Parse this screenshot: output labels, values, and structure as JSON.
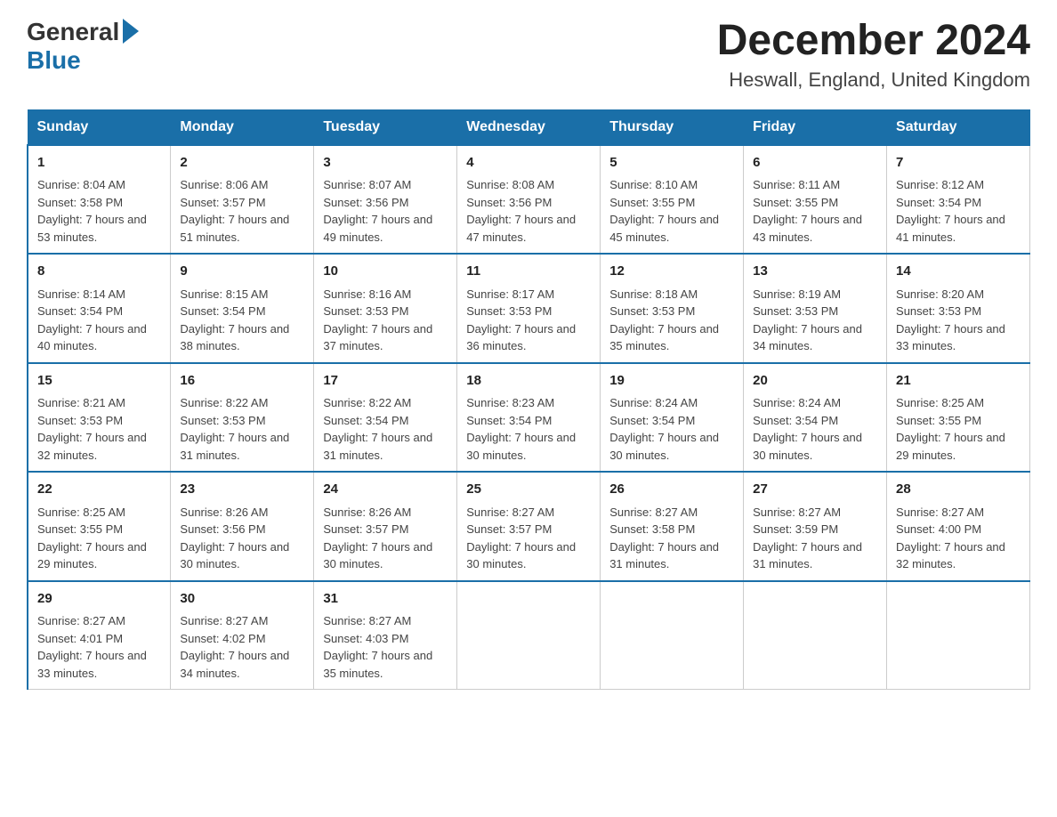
{
  "header": {
    "month_year": "December 2024",
    "location": "Heswall, England, United Kingdom",
    "logo_general": "General",
    "logo_blue": "Blue"
  },
  "days_of_week": [
    "Sunday",
    "Monday",
    "Tuesday",
    "Wednesday",
    "Thursday",
    "Friday",
    "Saturday"
  ],
  "weeks": [
    [
      {
        "day": "1",
        "sunrise": "Sunrise: 8:04 AM",
        "sunset": "Sunset: 3:58 PM",
        "daylight": "Daylight: 7 hours and 53 minutes."
      },
      {
        "day": "2",
        "sunrise": "Sunrise: 8:06 AM",
        "sunset": "Sunset: 3:57 PM",
        "daylight": "Daylight: 7 hours and 51 minutes."
      },
      {
        "day": "3",
        "sunrise": "Sunrise: 8:07 AM",
        "sunset": "Sunset: 3:56 PM",
        "daylight": "Daylight: 7 hours and 49 minutes."
      },
      {
        "day": "4",
        "sunrise": "Sunrise: 8:08 AM",
        "sunset": "Sunset: 3:56 PM",
        "daylight": "Daylight: 7 hours and 47 minutes."
      },
      {
        "day": "5",
        "sunrise": "Sunrise: 8:10 AM",
        "sunset": "Sunset: 3:55 PM",
        "daylight": "Daylight: 7 hours and 45 minutes."
      },
      {
        "day": "6",
        "sunrise": "Sunrise: 8:11 AM",
        "sunset": "Sunset: 3:55 PM",
        "daylight": "Daylight: 7 hours and 43 minutes."
      },
      {
        "day": "7",
        "sunrise": "Sunrise: 8:12 AM",
        "sunset": "Sunset: 3:54 PM",
        "daylight": "Daylight: 7 hours and 41 minutes."
      }
    ],
    [
      {
        "day": "8",
        "sunrise": "Sunrise: 8:14 AM",
        "sunset": "Sunset: 3:54 PM",
        "daylight": "Daylight: 7 hours and 40 minutes."
      },
      {
        "day": "9",
        "sunrise": "Sunrise: 8:15 AM",
        "sunset": "Sunset: 3:54 PM",
        "daylight": "Daylight: 7 hours and 38 minutes."
      },
      {
        "day": "10",
        "sunrise": "Sunrise: 8:16 AM",
        "sunset": "Sunset: 3:53 PM",
        "daylight": "Daylight: 7 hours and 37 minutes."
      },
      {
        "day": "11",
        "sunrise": "Sunrise: 8:17 AM",
        "sunset": "Sunset: 3:53 PM",
        "daylight": "Daylight: 7 hours and 36 minutes."
      },
      {
        "day": "12",
        "sunrise": "Sunrise: 8:18 AM",
        "sunset": "Sunset: 3:53 PM",
        "daylight": "Daylight: 7 hours and 35 minutes."
      },
      {
        "day": "13",
        "sunrise": "Sunrise: 8:19 AM",
        "sunset": "Sunset: 3:53 PM",
        "daylight": "Daylight: 7 hours and 34 minutes."
      },
      {
        "day": "14",
        "sunrise": "Sunrise: 8:20 AM",
        "sunset": "Sunset: 3:53 PM",
        "daylight": "Daylight: 7 hours and 33 minutes."
      }
    ],
    [
      {
        "day": "15",
        "sunrise": "Sunrise: 8:21 AM",
        "sunset": "Sunset: 3:53 PM",
        "daylight": "Daylight: 7 hours and 32 minutes."
      },
      {
        "day": "16",
        "sunrise": "Sunrise: 8:22 AM",
        "sunset": "Sunset: 3:53 PM",
        "daylight": "Daylight: 7 hours and 31 minutes."
      },
      {
        "day": "17",
        "sunrise": "Sunrise: 8:22 AM",
        "sunset": "Sunset: 3:54 PM",
        "daylight": "Daylight: 7 hours and 31 minutes."
      },
      {
        "day": "18",
        "sunrise": "Sunrise: 8:23 AM",
        "sunset": "Sunset: 3:54 PM",
        "daylight": "Daylight: 7 hours and 30 minutes."
      },
      {
        "day": "19",
        "sunrise": "Sunrise: 8:24 AM",
        "sunset": "Sunset: 3:54 PM",
        "daylight": "Daylight: 7 hours and 30 minutes."
      },
      {
        "day": "20",
        "sunrise": "Sunrise: 8:24 AM",
        "sunset": "Sunset: 3:54 PM",
        "daylight": "Daylight: 7 hours and 30 minutes."
      },
      {
        "day": "21",
        "sunrise": "Sunrise: 8:25 AM",
        "sunset": "Sunset: 3:55 PM",
        "daylight": "Daylight: 7 hours and 29 minutes."
      }
    ],
    [
      {
        "day": "22",
        "sunrise": "Sunrise: 8:25 AM",
        "sunset": "Sunset: 3:55 PM",
        "daylight": "Daylight: 7 hours and 29 minutes."
      },
      {
        "day": "23",
        "sunrise": "Sunrise: 8:26 AM",
        "sunset": "Sunset: 3:56 PM",
        "daylight": "Daylight: 7 hours and 30 minutes."
      },
      {
        "day": "24",
        "sunrise": "Sunrise: 8:26 AM",
        "sunset": "Sunset: 3:57 PM",
        "daylight": "Daylight: 7 hours and 30 minutes."
      },
      {
        "day": "25",
        "sunrise": "Sunrise: 8:27 AM",
        "sunset": "Sunset: 3:57 PM",
        "daylight": "Daylight: 7 hours and 30 minutes."
      },
      {
        "day": "26",
        "sunrise": "Sunrise: 8:27 AM",
        "sunset": "Sunset: 3:58 PM",
        "daylight": "Daylight: 7 hours and 31 minutes."
      },
      {
        "day": "27",
        "sunrise": "Sunrise: 8:27 AM",
        "sunset": "Sunset: 3:59 PM",
        "daylight": "Daylight: 7 hours and 31 minutes."
      },
      {
        "day": "28",
        "sunrise": "Sunrise: 8:27 AM",
        "sunset": "Sunset: 4:00 PM",
        "daylight": "Daylight: 7 hours and 32 minutes."
      }
    ],
    [
      {
        "day": "29",
        "sunrise": "Sunrise: 8:27 AM",
        "sunset": "Sunset: 4:01 PM",
        "daylight": "Daylight: 7 hours and 33 minutes."
      },
      {
        "day": "30",
        "sunrise": "Sunrise: 8:27 AM",
        "sunset": "Sunset: 4:02 PM",
        "daylight": "Daylight: 7 hours and 34 minutes."
      },
      {
        "day": "31",
        "sunrise": "Sunrise: 8:27 AM",
        "sunset": "Sunset: 4:03 PM",
        "daylight": "Daylight: 7 hours and 35 minutes."
      },
      null,
      null,
      null,
      null
    ]
  ]
}
